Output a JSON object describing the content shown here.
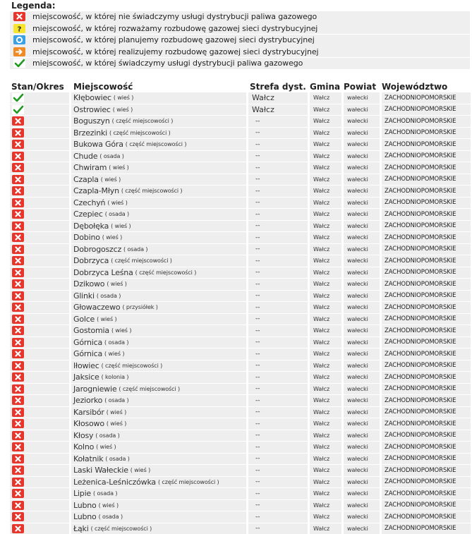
{
  "legend": {
    "title": "Legenda:",
    "items": [
      {
        "icon": "x-icon",
        "text": "miejscowość, w której nie świadczymy usługi dystrybucji paliwa gazowego"
      },
      {
        "icon": "question-icon",
        "text": "miejscowość, w której rozważamy rozbudowę gazowej sieci dystrybucyjnej"
      },
      {
        "icon": "circle-icon",
        "text": "miejscowość, w której planujemy rozbudowę gazowej sieci dystrybucyjnej"
      },
      {
        "icon": "arrow-icon",
        "text": "miejscowość, w której realizujemy rozbudowę gazowej sieci dystrybucyjnej"
      },
      {
        "icon": "check-icon",
        "text": "miejscowość, w której świadczymy usługi dystrybucji paliwa gazowego"
      }
    ]
  },
  "table": {
    "headers": {
      "status": "Stan/Okres",
      "name": "Miejscowość",
      "zone": "Strefa dyst.",
      "gmina": "Gmina",
      "powiat": "Powiat",
      "woj": "Województwo"
    },
    "rows": [
      {
        "status": "check",
        "name": "Kłębowiec",
        "type": "( wieś )",
        "zone": "Wałcz",
        "gmina": "Wałcz",
        "powiat": "wałecki",
        "woj": "ZACHODNIOPOMORSKIE"
      },
      {
        "status": "check",
        "name": "Ostrowiec",
        "type": "( wieś )",
        "zone": "Wałcz",
        "gmina": "Wałcz",
        "powiat": "wałecki",
        "woj": "ZACHODNIOPOMORSKIE"
      },
      {
        "status": "x",
        "name": "Boguszyn",
        "type": "( część miejscowości )",
        "zone": "--",
        "gmina": "Wałcz",
        "powiat": "wałecki",
        "woj": "ZACHODNIOPOMORSKIE"
      },
      {
        "status": "x",
        "name": "Brzezinki",
        "type": "( część miejscowości )",
        "zone": "--",
        "gmina": "Wałcz",
        "powiat": "wałecki",
        "woj": "ZACHODNIOPOMORSKIE"
      },
      {
        "status": "x",
        "name": "Bukowa Góra",
        "type": "( część miejscowości )",
        "zone": "--",
        "gmina": "Wałcz",
        "powiat": "wałecki",
        "woj": "ZACHODNIOPOMORSKIE"
      },
      {
        "status": "x",
        "name": "Chude",
        "type": "( osada )",
        "zone": "--",
        "gmina": "Wałcz",
        "powiat": "wałecki",
        "woj": "ZACHODNIOPOMORSKIE"
      },
      {
        "status": "x",
        "name": "Chwiram",
        "type": "( wieś )",
        "zone": "--",
        "gmina": "Wałcz",
        "powiat": "wałecki",
        "woj": "ZACHODNIOPOMORSKIE"
      },
      {
        "status": "x",
        "name": "Czapla",
        "type": "( wieś )",
        "zone": "--",
        "gmina": "Wałcz",
        "powiat": "wałecki",
        "woj": "ZACHODNIOPOMORSKIE"
      },
      {
        "status": "x",
        "name": "Czapla-Młyn",
        "type": "( część miejscowości )",
        "zone": "--",
        "gmina": "Wałcz",
        "powiat": "wałecki",
        "woj": "ZACHODNIOPOMORSKIE"
      },
      {
        "status": "x",
        "name": "Czechyń",
        "type": "( wieś )",
        "zone": "--",
        "gmina": "Wałcz",
        "powiat": "wałecki",
        "woj": "ZACHODNIOPOMORSKIE"
      },
      {
        "status": "x",
        "name": "Czepiec",
        "type": "( osada )",
        "zone": "--",
        "gmina": "Wałcz",
        "powiat": "wałecki",
        "woj": "ZACHODNIOPOMORSKIE"
      },
      {
        "status": "x",
        "name": "Dębołęka",
        "type": "( wieś )",
        "zone": "--",
        "gmina": "Wałcz",
        "powiat": "wałecki",
        "woj": "ZACHODNIOPOMORSKIE"
      },
      {
        "status": "x",
        "name": "Dobino",
        "type": "( wieś )",
        "zone": "--",
        "gmina": "Wałcz",
        "powiat": "wałecki",
        "woj": "ZACHODNIOPOMORSKIE"
      },
      {
        "status": "x",
        "name": "Dobrogoszcz",
        "type": "( osada )",
        "zone": "--",
        "gmina": "Wałcz",
        "powiat": "wałecki",
        "woj": "ZACHODNIOPOMORSKIE"
      },
      {
        "status": "x",
        "name": "Dobrzyca",
        "type": "( część miejscowości )",
        "zone": "--",
        "gmina": "Wałcz",
        "powiat": "wałecki",
        "woj": "ZACHODNIOPOMORSKIE"
      },
      {
        "status": "x",
        "name": "Dobrzyca Leśna",
        "type": "( część miejscowości )",
        "zone": "--",
        "gmina": "Wałcz",
        "powiat": "wałecki",
        "woj": "ZACHODNIOPOMORSKIE"
      },
      {
        "status": "x",
        "name": "Dzikowo",
        "type": "( wieś )",
        "zone": "--",
        "gmina": "Wałcz",
        "powiat": "wałecki",
        "woj": "ZACHODNIOPOMORSKIE"
      },
      {
        "status": "x",
        "name": "Glinki",
        "type": "( osada )",
        "zone": "--",
        "gmina": "Wałcz",
        "powiat": "wałecki",
        "woj": "ZACHODNIOPOMORSKIE"
      },
      {
        "status": "x",
        "name": "Głowaczewo",
        "type": "( przysiółek )",
        "zone": "--",
        "gmina": "Wałcz",
        "powiat": "wałecki",
        "woj": "ZACHODNIOPOMORSKIE"
      },
      {
        "status": "x",
        "name": "Golce",
        "type": "( wieś )",
        "zone": "--",
        "gmina": "Wałcz",
        "powiat": "wałecki",
        "woj": "ZACHODNIOPOMORSKIE"
      },
      {
        "status": "x",
        "name": "Gostomia",
        "type": "( wieś )",
        "zone": "--",
        "gmina": "Wałcz",
        "powiat": "wałecki",
        "woj": "ZACHODNIOPOMORSKIE"
      },
      {
        "status": "x",
        "name": "Górnica",
        "type": "( osada )",
        "zone": "--",
        "gmina": "Wałcz",
        "powiat": "wałecki",
        "woj": "ZACHODNIOPOMORSKIE"
      },
      {
        "status": "x",
        "name": "Górnica",
        "type": "( wieś )",
        "zone": "--",
        "gmina": "Wałcz",
        "powiat": "wałecki",
        "woj": "ZACHODNIOPOMORSKIE"
      },
      {
        "status": "x",
        "name": "Iłowiec",
        "type": "( część miejscowości )",
        "zone": "--",
        "gmina": "Wałcz",
        "powiat": "wałecki",
        "woj": "ZACHODNIOPOMORSKIE"
      },
      {
        "status": "x",
        "name": "Jaksice",
        "type": "( kolonia )",
        "zone": "--",
        "gmina": "Wałcz",
        "powiat": "wałecki",
        "woj": "ZACHODNIOPOMORSKIE"
      },
      {
        "status": "x",
        "name": "Jarogniewie",
        "type": "( część miejscowości )",
        "zone": "--",
        "gmina": "Wałcz",
        "powiat": "wałecki",
        "woj": "ZACHODNIOPOMORSKIE"
      },
      {
        "status": "x",
        "name": "Jeziorko",
        "type": "( osada )",
        "zone": "--",
        "gmina": "Wałcz",
        "powiat": "wałecki",
        "woj": "ZACHODNIOPOMORSKIE"
      },
      {
        "status": "x",
        "name": "Karsibór",
        "type": "( wieś )",
        "zone": "--",
        "gmina": "Wałcz",
        "powiat": "wałecki",
        "woj": "ZACHODNIOPOMORSKIE"
      },
      {
        "status": "x",
        "name": "Kłosowo",
        "type": "( wieś )",
        "zone": "--",
        "gmina": "Wałcz",
        "powiat": "wałecki",
        "woj": "ZACHODNIOPOMORSKIE"
      },
      {
        "status": "x",
        "name": "Kłosy",
        "type": "( osada )",
        "zone": "--",
        "gmina": "Wałcz",
        "powiat": "wałecki",
        "woj": "ZACHODNIOPOMORSKIE"
      },
      {
        "status": "x",
        "name": "Kolno",
        "type": "( wieś )",
        "zone": "--",
        "gmina": "Wałcz",
        "powiat": "wałecki",
        "woj": "ZACHODNIOPOMORSKIE"
      },
      {
        "status": "x",
        "name": "Kołatnik",
        "type": "( osada )",
        "zone": "--",
        "gmina": "Wałcz",
        "powiat": "wałecki",
        "woj": "ZACHODNIOPOMORSKIE"
      },
      {
        "status": "x",
        "name": "Laski Wałeckie",
        "type": "( wieś )",
        "zone": "--",
        "gmina": "Wałcz",
        "powiat": "wałecki",
        "woj": "ZACHODNIOPOMORSKIE"
      },
      {
        "status": "x",
        "name": "Leżenica-Leśniczówka",
        "type": "( część miejscowości )",
        "zone": "--",
        "gmina": "Wałcz",
        "powiat": "wałecki",
        "woj": "ZACHODNIOPOMORSKIE"
      },
      {
        "status": "x",
        "name": "Lipie",
        "type": "( osada )",
        "zone": "--",
        "gmina": "Wałcz",
        "powiat": "wałecki",
        "woj": "ZACHODNIOPOMORSKIE"
      },
      {
        "status": "x",
        "name": "Lubno",
        "type": "( wieś )",
        "zone": "--",
        "gmina": "Wałcz",
        "powiat": "wałecki",
        "woj": "ZACHODNIOPOMORSKIE"
      },
      {
        "status": "x",
        "name": "Lubno",
        "type": "( osada )",
        "zone": "--",
        "gmina": "Wałcz",
        "powiat": "wałecki",
        "woj": "ZACHODNIOPOMORSKIE"
      },
      {
        "status": "x",
        "name": "Łąki",
        "type": "( część miejscowości )",
        "zone": "--",
        "gmina": "Wałcz",
        "powiat": "wałecki",
        "woj": "ZACHODNIOPOMORSKIE"
      }
    ]
  },
  "colors": {
    "x_icon": "#e8352b",
    "question_icon": "#f7e42e",
    "circle_icon": "#3aa1e6",
    "arrow_icon": "#f08a24",
    "check_icon": "#1f9a1f",
    "row_bg": "#eeeeee"
  }
}
